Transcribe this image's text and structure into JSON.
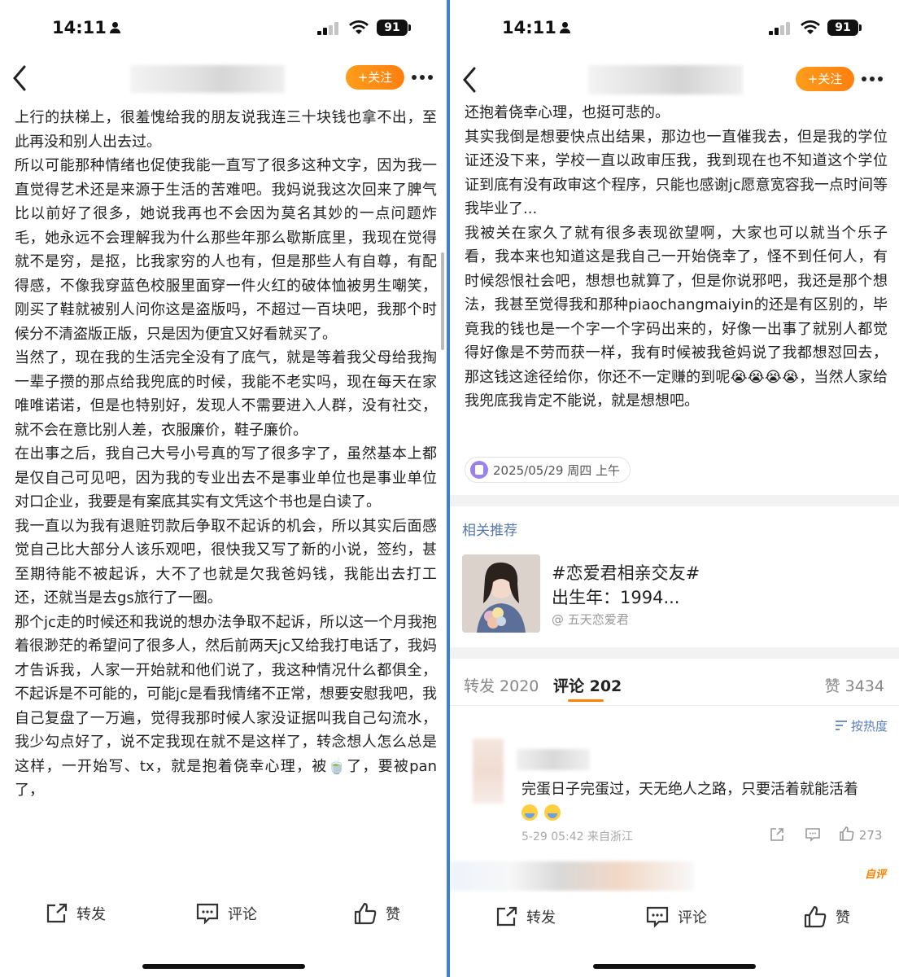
{
  "left": {
    "status": {
      "time": "14:11",
      "battery": "91"
    },
    "nav": {
      "follow_label": "+关注"
    },
    "paragraphs": [
      "上行的扶梯上，很羞愧给我的朋友说我连三十块钱也拿不出，至此再没和别人出去过。",
      "所以可能那种情绪也促使我能一直写了很多这种文字，因为我一直觉得艺术还是来源于生活的苦难吧。我妈说我这次回来了脾气比以前好了很多，她说我再也不会因为莫名其妙的一点问题炸毛，她永远不会理解我为什么那些年那么歇斯底里，我现在觉得就不是穷，是抠，比我家穷的人也有，但是那些人有自尊，有配得感，不像我穿蓝色校服里面穿一件火红的破体恤被男生嘲笑，刚买了鞋就被别人问你这是盗版吗，不超过一百块吧，我那个时候分不清盗版正版，只是因为便宜又好看就买了。",
      "当然了，现在我的生活完全没有了底气，就是等着我父母给我掏一辈子攒的那点给我兜底的时候，我能不老实吗，现在每天在家唯唯诺诺，但是也特别好，发现人不需要进入人群，没有社交，就不会在意比别人差，衣服廉价，鞋子廉价。",
      "在出事之后，我自己大号小号真的写了很多字了，虽然基本上都是仅自己可见吧，因为我的专业出去不是事业单位也是事业单位对口企业，我要是有案底其实有文凭这个书也是白读了。",
      "我一直以为我有退赃罚款后争取不起诉的机会，所以其实后面感觉自己比大部分人该乐观吧，很快我又写了新的小说，签约，甚至期待能不被起诉，大不了也就是欠我爸妈钱，我能出去打工还，还就当是去gs旅行了一圈。",
      "那个jc走的时候还和我说的想办法争取不起诉，所以这一个月我抱着很渺茫的希望问了很多人，然后前两天jc又给我打电话了，我妈才告诉我，人家一开始就和他们说了，我这种情况什么都俱全，不起诉是不可能的，可能jc是看我情绪不正常，想要安慰我吧，我自己复盘了一万遍，觉得我那时候人家没证据叫我自己勾流水，我少勾点好了，说不定我现在就不是这样了，转念想人怎么总是这样，一开始写、tx，就是抱着侥幸心理，被🍵了，要被pan了，"
    ],
    "actions": {
      "repost": "转发",
      "comment": "评论",
      "like": "赞"
    }
  },
  "right": {
    "status": {
      "time": "14:11",
      "battery": "91"
    },
    "nav": {
      "follow_label": "+关注"
    },
    "paragraphs": [
      "还抱着侥幸心理，也挺可悲的。",
      "其实我倒是想要快点出结果，那边也一直催我去，但是我的学位证还没下来，学校一直以政审压我，我到现在也不知道这个学位证到底有没有政审这个程序，只能也感谢jc愿意宽容我一点时间等我毕业了...",
      "我被关在家久了就有很多表现欲望啊，大家也可以就当个乐子看，我本来也知道这是我自己一开始侥幸了，怪不到任何人，有时候怨恨社会吧，想想也就算了，但是你说邪吧，我还是那个想法，我甚至觉得我和那种piaochangmaiyin的还是有区别的，毕竟我的钱也是一个字一个字码出来的，好像一出事了就别人都觉得好像是不劳而获一样，我有时候被我爸妈说了我都想怼回去，那这钱这途径给你，你还不一定赚的到呢😭😭😭😭，当然人家给我兜底我肯定不能说，就是想想吧。"
    ],
    "date_chip": "2025/05/29 周四 上午",
    "recommend": {
      "section_title": "相关推荐",
      "title": "#恋爱君相亲交友#",
      "subtitle": "出生年：1994...",
      "source": "@ 五天恋爱君"
    },
    "tabs": {
      "repost": "转发 2020",
      "comment": "评论 202",
      "like": "赞 3434"
    },
    "sort_label": "按热度",
    "comment": {
      "text": "完蛋日子完蛋过，天无绝人之路，只要活着就能活着",
      "meta": "5-29 05:42 来自浙江",
      "likes": "273"
    },
    "self_tag": "自评",
    "actions": {
      "repost": "转发",
      "comment": "评论",
      "like": "赞"
    }
  }
}
